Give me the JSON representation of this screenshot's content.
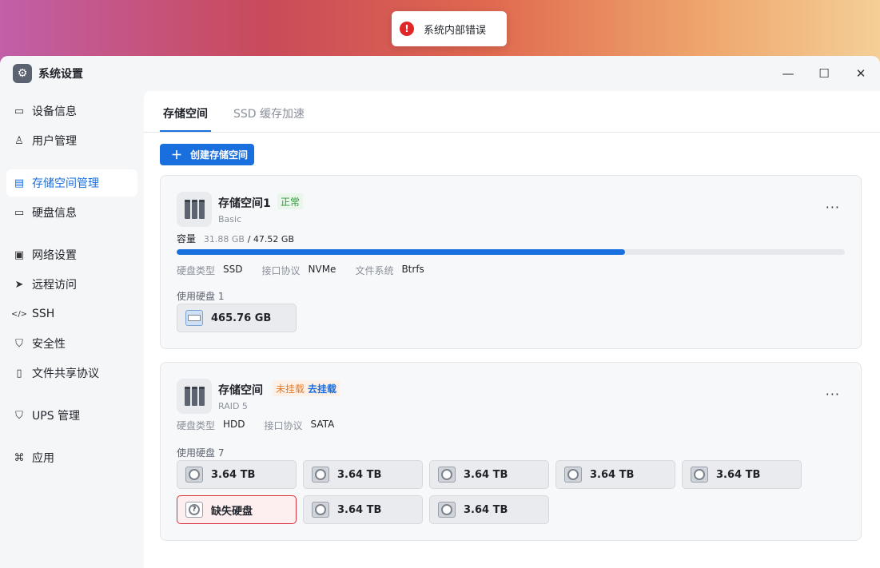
{
  "toast": {
    "message": "系统内部错误"
  },
  "window": {
    "title": "系统设置"
  },
  "sidebar": {
    "items": [
      {
        "label": "设备信息",
        "icon": "device-icon"
      },
      {
        "label": "用户管理",
        "icon": "user-icon"
      },
      {
        "label": "存储空间管理",
        "icon": "storage-icon",
        "active": true
      },
      {
        "label": "硬盘信息",
        "icon": "disk-icon"
      },
      {
        "label": "网络设置",
        "icon": "network-icon"
      },
      {
        "label": "远程访问",
        "icon": "remote-icon"
      },
      {
        "label": "SSH",
        "icon": "code-icon"
      },
      {
        "label": "安全性",
        "icon": "shield-icon"
      },
      {
        "label": "文件共享协议",
        "icon": "file-icon"
      },
      {
        "label": "UPS 管理",
        "icon": "ups-icon"
      },
      {
        "label": "应用",
        "icon": "apps-icon"
      }
    ]
  },
  "tabs": [
    "存储空间",
    "SSD 缓存加速"
  ],
  "create_button": "创建存储空间",
  "pool1": {
    "name": "存储空间1",
    "status": "正常",
    "raid": "Basic",
    "capacity_label": "容量",
    "used": "31.88 GB",
    "total": "/ 47.52 GB",
    "usage_fraction": 0.671,
    "specs": [
      {
        "k": "硬盘类型",
        "v": "SSD"
      },
      {
        "k": "接口协议",
        "v": "NVMe"
      },
      {
        "k": "文件系统",
        "v": "Btrfs"
      }
    ],
    "disks_label": "使用硬盘 1",
    "disks": [
      "465.76 GB"
    ]
  },
  "pool2": {
    "name": "存储空间",
    "status": "未挂载",
    "action": "去挂载",
    "raid": "RAID 5",
    "specs": [
      {
        "k": "硬盘类型",
        "v": "HDD"
      },
      {
        "k": "接口协议",
        "v": "SATA"
      }
    ],
    "disks_label": "使用硬盘 7",
    "disks": [
      "3.64 TB",
      "3.64 TB",
      "3.64 TB",
      "3.64 TB",
      "3.64 TB",
      "缺失硬盘",
      "3.64 TB",
      "3.64 TB"
    ]
  },
  "colors": {
    "accent": "#1a6fde",
    "ok": "#2c9a3a",
    "warn": "#e27b2b",
    "error": "#e02727"
  }
}
